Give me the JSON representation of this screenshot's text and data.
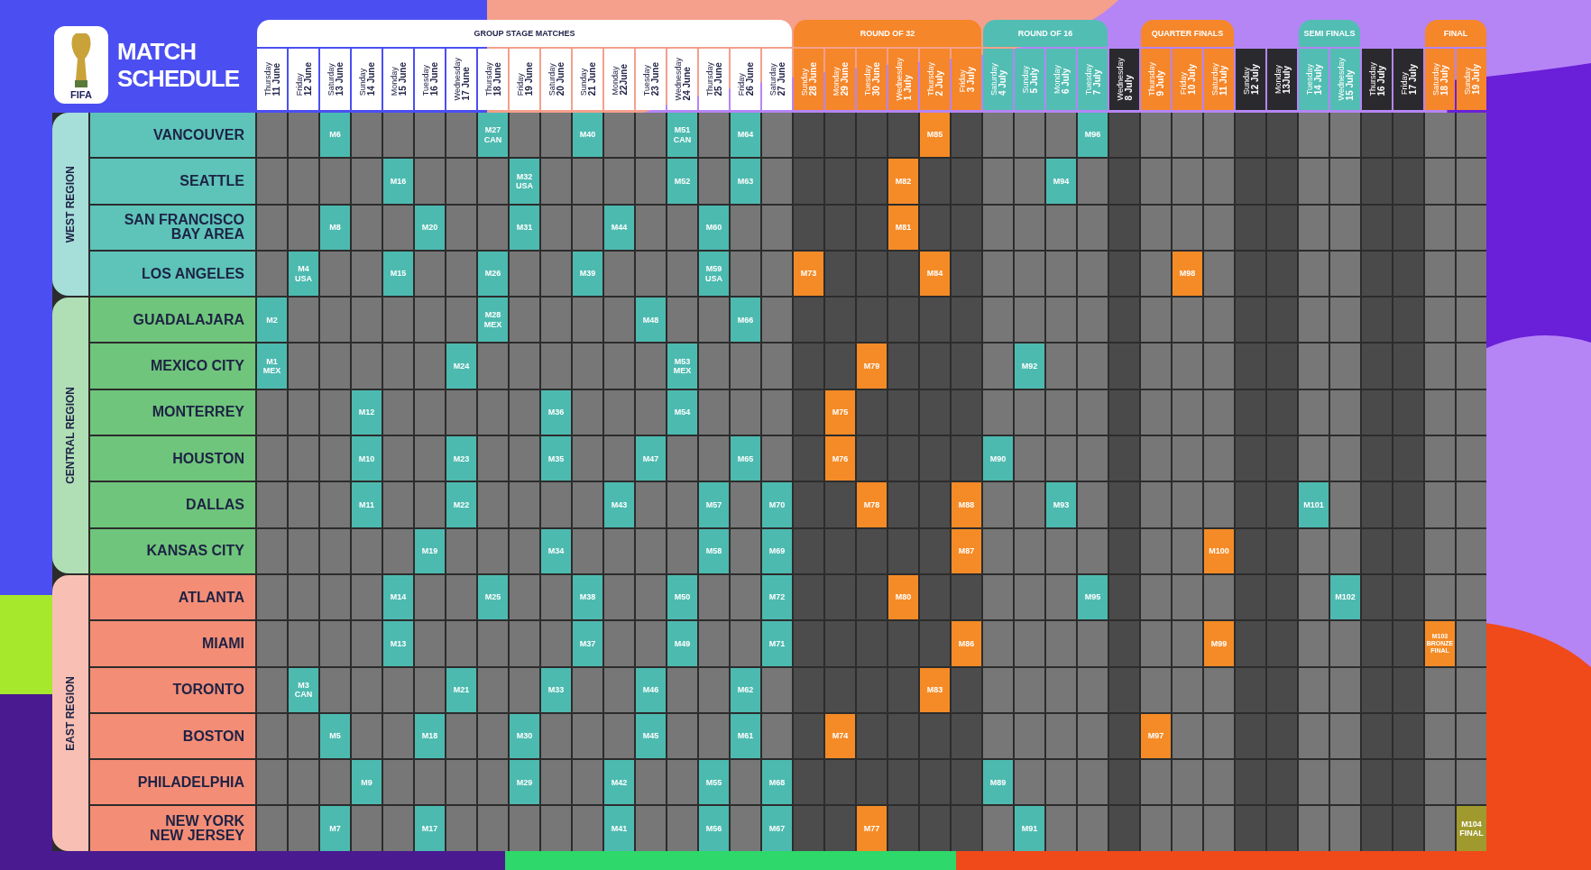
{
  "brand": {
    "logo_text": "FIFA",
    "title": "MATCH\nSCHEDULE"
  },
  "stages": [
    {
      "label": "GROUP STAGE MATCHES",
      "kind": "group",
      "days": [
        {
          "day": "Thursday",
          "date": "11 June"
        },
        {
          "day": "Friday",
          "date": "12 June"
        },
        {
          "day": "Saturday",
          "date": "13 June"
        },
        {
          "day": "Sunday",
          "date": "14 June"
        },
        {
          "day": "Monday",
          "date": "15 June"
        },
        {
          "day": "Tuesday",
          "date": "16 June"
        },
        {
          "day": "Wednesday",
          "date": "17 June"
        },
        {
          "day": "Thursday",
          "date": "18 June"
        },
        {
          "day": "Friday",
          "date": "19 June"
        },
        {
          "day": "Saturday",
          "date": "20 June"
        },
        {
          "day": "Sunday",
          "date": "21 June"
        },
        {
          "day": "Monday",
          "date": "22June"
        },
        {
          "day": "Tuesday",
          "date": "23 June"
        },
        {
          "day": "Wednesday",
          "date": "24 June"
        },
        {
          "day": "Thursday",
          "date": "25 June"
        },
        {
          "day": "Friday",
          "date": "26 June"
        },
        {
          "day": "Saturday",
          "date": "27 June"
        }
      ]
    },
    {
      "label": "ROUND OF 32",
      "kind": "round-of-32",
      "days": [
        {
          "day": "Sunday",
          "date": "28 June"
        },
        {
          "day": "Monday",
          "date": "29 June"
        },
        {
          "day": "Tuesday",
          "date": "30 June"
        },
        {
          "day": "Wednesday",
          "date": "1 July"
        },
        {
          "day": "Thursday",
          "date": "2 July"
        },
        {
          "day": "Friday",
          "date": "3 July"
        }
      ]
    },
    {
      "label": "ROUND OF 16",
      "kind": "round-of-16",
      "days": [
        {
          "day": "Saturday",
          "date": "4 July"
        },
        {
          "day": "Sunday",
          "date": "5 July"
        },
        {
          "day": "Monday",
          "date": "6 July"
        },
        {
          "day": "Tuesday",
          "date": "7 July"
        }
      ]
    },
    {
      "kind": "rest",
      "days": [
        {
          "day": "Wednesday",
          "date": "8 July"
        }
      ]
    },
    {
      "label": "QUARTER FINALS",
      "kind": "quarter-finals",
      "days": [
        {
          "day": "Thursday",
          "date": "9 July"
        },
        {
          "day": "Friday",
          "date": "10 July"
        },
        {
          "day": "Saturday",
          "date": "11 July"
        }
      ]
    },
    {
      "kind": "rest",
      "days": [
        {
          "day": "Sunday",
          "date": "12 July"
        },
        {
          "day": "Monday",
          "date": "13July"
        }
      ]
    },
    {
      "label": "SEMI FINALS",
      "kind": "semi-finals",
      "days": [
        {
          "day": "Tuesday",
          "date": "14 July"
        },
        {
          "day": "Wednesday",
          "date": "15 July"
        }
      ]
    },
    {
      "kind": "rest",
      "days": [
        {
          "day": "Thursday",
          "date": "16 July"
        },
        {
          "day": "Friday",
          "date": "17 July"
        }
      ]
    },
    {
      "label": "FINAL",
      "kind": "final",
      "days": [
        {
          "day": "Saturday",
          "date": "18 July"
        },
        {
          "day": "Sunday",
          "date": "19 July"
        }
      ]
    }
  ],
  "regions": [
    {
      "label": "WEST REGION",
      "color": "#5ec3b9",
      "cities": [
        {
          "name": "VANCOUVER",
          "cells": [
            null,
            null,
            {
              "label": "M6",
              "color": "#4dbab0"
            },
            null,
            null,
            null,
            null,
            {
              "label": "M27\nCAN",
              "color": "#4dbab0"
            },
            null,
            null,
            {
              "label": "M40",
              "color": "#4dbab0"
            },
            null,
            null,
            {
              "label": "M51\nCAN",
              "color": "#4dbab0"
            },
            null,
            {
              "label": "M64",
              "color": "#4dbab0"
            },
            null,
            null,
            null,
            null,
            null,
            {
              "label": "M85",
              "color": "#f58b26"
            },
            null,
            null,
            null,
            null,
            {
              "label": "M96",
              "color": "#4dbab0"
            },
            null,
            null,
            null,
            null,
            null,
            null,
            null,
            null,
            null,
            null,
            null,
            null
          ]
        },
        {
          "name": "SEATTLE",
          "cells": [
            null,
            null,
            null,
            null,
            {
              "label": "M16",
              "color": "#4dbab0"
            },
            null,
            null,
            null,
            {
              "label": "M32\nUSA",
              "color": "#4dbab0"
            },
            null,
            null,
            null,
            null,
            {
              "label": "M52",
              "color": "#4dbab0"
            },
            null,
            {
              "label": "M63",
              "color": "#4dbab0"
            },
            null,
            null,
            null,
            null,
            {
              "label": "M82",
              "color": "#f58b26"
            },
            null,
            null,
            null,
            null,
            {
              "label": "M94",
              "color": "#4dbab0"
            },
            null,
            null,
            null,
            null,
            null,
            null,
            null,
            null,
            null,
            null,
            null,
            null,
            null
          ]
        },
        {
          "name": "SAN FRANCISCO\nBAY AREA",
          "cells": [
            null,
            null,
            {
              "label": "M8",
              "color": "#4dbab0"
            },
            null,
            null,
            {
              "label": "M20",
              "color": "#4dbab0"
            },
            null,
            null,
            {
              "label": "M31",
              "color": "#4dbab0"
            },
            null,
            null,
            {
              "label": "M44",
              "color": "#4dbab0"
            },
            null,
            null,
            {
              "label": "M60",
              "color": "#4dbab0"
            },
            null,
            null,
            null,
            null,
            null,
            {
              "label": "M81",
              "color": "#f58b26"
            },
            null,
            null,
            null,
            null,
            null,
            null,
            null,
            null,
            null,
            null,
            null,
            null,
            null,
            null,
            null,
            null,
            null,
            null
          ]
        },
        {
          "name": "LOS ANGELES",
          "cells": [
            null,
            {
              "label": "M4\nUSA",
              "color": "#4dbab0"
            },
            null,
            null,
            {
              "label": "M15",
              "color": "#4dbab0"
            },
            null,
            null,
            {
              "label": "M26",
              "color": "#4dbab0"
            },
            null,
            null,
            {
              "label": "M39",
              "color": "#4dbab0"
            },
            null,
            null,
            null,
            {
              "label": "M59\nUSA",
              "color": "#4dbab0"
            },
            null,
            null,
            {
              "label": "M73",
              "color": "#f58b26"
            },
            null,
            null,
            null,
            {
              "label": "M84",
              "color": "#f58b26"
            },
            null,
            null,
            null,
            null,
            null,
            null,
            null,
            {
              "label": "M98",
              "color": "#f58b26"
            },
            null,
            null,
            null,
            null,
            null,
            null,
            null,
            null,
            null
          ]
        }
      ]
    },
    {
      "label": "CENTRAL REGION",
      "color": "#6fc57b",
      "cities": [
        {
          "name": "GUADALAJARA",
          "cells": [
            {
              "label": "M2",
              "color": "#4dbab0"
            },
            null,
            null,
            null,
            null,
            null,
            null,
            {
              "label": "M28\nMEX",
              "color": "#4dbab0"
            },
            null,
            null,
            null,
            null,
            {
              "label": "M48",
              "color": "#4dbab0"
            },
            null,
            null,
            {
              "label": "M66",
              "color": "#4dbab0"
            },
            null,
            null,
            null,
            null,
            null,
            null,
            null,
            null,
            null,
            null,
            null,
            null,
            null,
            null,
            null,
            null,
            null,
            null,
            null,
            null,
            null,
            null,
            null
          ]
        },
        {
          "name": "MEXICO CITY",
          "cells": [
            {
              "label": "M1\nMEX",
              "color": "#4dbab0"
            },
            null,
            null,
            null,
            null,
            null,
            {
              "label": "M24",
              "color": "#4dbab0"
            },
            null,
            null,
            null,
            null,
            null,
            null,
            {
              "label": "M53\nMEX",
              "color": "#4dbab0"
            },
            null,
            null,
            null,
            null,
            null,
            {
              "label": "M79",
              "color": "#f58b26"
            },
            null,
            null,
            null,
            null,
            {
              "label": "M92",
              "color": "#4dbab0"
            },
            null,
            null,
            null,
            null,
            null,
            null,
            null,
            null,
            null,
            null,
            null,
            null,
            null,
            null
          ]
        },
        {
          "name": "MONTERREY",
          "cells": [
            null,
            null,
            null,
            {
              "label": "M12",
              "color": "#4dbab0"
            },
            null,
            null,
            null,
            null,
            null,
            {
              "label": "M36",
              "color": "#4dbab0"
            },
            null,
            null,
            null,
            {
              "label": "M54",
              "color": "#4dbab0"
            },
            null,
            null,
            null,
            null,
            {
              "label": "M75",
              "color": "#f58b26"
            },
            null,
            null,
            null,
            null,
            null,
            null,
            null,
            null,
            null,
            null,
            null,
            null,
            null,
            null,
            null,
            null,
            null,
            null,
            null,
            null
          ]
        },
        {
          "name": "HOUSTON",
          "cells": [
            null,
            null,
            null,
            {
              "label": "M10",
              "color": "#4dbab0"
            },
            null,
            null,
            {
              "label": "M23",
              "color": "#4dbab0"
            },
            null,
            null,
            {
              "label": "M35",
              "color": "#4dbab0"
            },
            null,
            null,
            {
              "label": "M47",
              "color": "#4dbab0"
            },
            null,
            null,
            {
              "label": "M65",
              "color": "#4dbab0"
            },
            null,
            null,
            {
              "label": "M76",
              "color": "#f58b26"
            },
            null,
            null,
            null,
            null,
            {
              "label": "M90",
              "color": "#4dbab0"
            },
            null,
            null,
            null,
            null,
            null,
            null,
            null,
            null,
            null,
            null,
            null,
            null,
            null,
            null,
            null
          ]
        },
        {
          "name": "DALLAS",
          "cells": [
            null,
            null,
            null,
            {
              "label": "M11",
              "color": "#4dbab0"
            },
            null,
            null,
            {
              "label": "M22",
              "color": "#4dbab0"
            },
            null,
            null,
            null,
            null,
            {
              "label": "M43",
              "color": "#4dbab0"
            },
            null,
            null,
            {
              "label": "M57",
              "color": "#4dbab0"
            },
            null,
            {
              "label": "M70",
              "color": "#4dbab0"
            },
            null,
            null,
            {
              "label": "M78",
              "color": "#f58b26"
            },
            null,
            null,
            {
              "label": "M88",
              "color": "#f58b26"
            },
            null,
            null,
            {
              "label": "M93",
              "color": "#4dbab0"
            },
            null,
            null,
            null,
            null,
            null,
            null,
            null,
            {
              "label": "M101",
              "color": "#4dbab0"
            },
            null,
            null,
            null,
            null,
            null
          ]
        },
        {
          "name": "KANSAS CITY",
          "cells": [
            null,
            null,
            null,
            null,
            null,
            {
              "label": "M19",
              "color": "#4dbab0"
            },
            null,
            null,
            null,
            {
              "label": "M34",
              "color": "#4dbab0"
            },
            null,
            null,
            null,
            null,
            {
              "label": "M58",
              "color": "#4dbab0"
            },
            null,
            {
              "label": "M69",
              "color": "#4dbab0"
            },
            null,
            null,
            null,
            null,
            null,
            {
              "label": "M87",
              "color": "#f58b26"
            },
            null,
            null,
            null,
            null,
            null,
            null,
            null,
            {
              "label": "M100",
              "color": "#f58b26"
            },
            null,
            null,
            null,
            null,
            null,
            null,
            null,
            null
          ]
        }
      ]
    },
    {
      "label": "EAST REGION",
      "color": "#f38d76",
      "cities": [
        {
          "name": "ATLANTA",
          "cells": [
            null,
            null,
            null,
            null,
            {
              "label": "M14",
              "color": "#4dbab0"
            },
            null,
            null,
            {
              "label": "M25",
              "color": "#4dbab0"
            },
            null,
            null,
            {
              "label": "M38",
              "color": "#4dbab0"
            },
            null,
            null,
            {
              "label": "M50",
              "color": "#4dbab0"
            },
            null,
            null,
            {
              "label": "M72",
              "color": "#4dbab0"
            },
            null,
            null,
            null,
            {
              "label": "M80",
              "color": "#f58b26"
            },
            null,
            null,
            null,
            null,
            null,
            {
              "label": "M95",
              "color": "#4dbab0"
            },
            null,
            null,
            null,
            null,
            null,
            null,
            null,
            {
              "label": "M102",
              "color": "#4dbab0"
            },
            null,
            null,
            null,
            null
          ]
        },
        {
          "name": "MIAMI",
          "cells": [
            null,
            null,
            null,
            null,
            {
              "label": "M13",
              "color": "#4dbab0"
            },
            null,
            null,
            null,
            null,
            null,
            {
              "label": "M37",
              "color": "#4dbab0"
            },
            null,
            null,
            {
              "label": "M49",
              "color": "#4dbab0"
            },
            null,
            null,
            {
              "label": "M71",
              "color": "#4dbab0"
            },
            null,
            null,
            null,
            null,
            null,
            {
              "label": "M86",
              "color": "#f58b26"
            },
            null,
            null,
            null,
            null,
            null,
            null,
            null,
            {
              "label": "M99",
              "color": "#f58b26"
            },
            null,
            null,
            null,
            null,
            null,
            null,
            {
              "label": "M103\nBRONZE\nFINAL",
              "color": "#f58b26"
            },
            null
          ]
        },
        {
          "name": "TORONTO",
          "cells": [
            null,
            {
              "label": "M3\nCAN",
              "color": "#4dbab0"
            },
            null,
            null,
            null,
            null,
            {
              "label": "M21",
              "color": "#4dbab0"
            },
            null,
            null,
            {
              "label": "M33",
              "color": "#4dbab0"
            },
            null,
            null,
            {
              "label": "M46",
              "color": "#4dbab0"
            },
            null,
            null,
            {
              "label": "M62",
              "color": "#4dbab0"
            },
            null,
            null,
            null,
            null,
            null,
            {
              "label": "M83",
              "color": "#f58b26"
            },
            null,
            null,
            null,
            null,
            null,
            null,
            null,
            null,
            null,
            null,
            null,
            null,
            null,
            null,
            null,
            null,
            null
          ]
        },
        {
          "name": "BOSTON",
          "cells": [
            null,
            null,
            {
              "label": "M5",
              "color": "#4dbab0"
            },
            null,
            null,
            {
              "label": "M18",
              "color": "#4dbab0"
            },
            null,
            null,
            {
              "label": "M30",
              "color": "#4dbab0"
            },
            null,
            null,
            null,
            {
              "label": "M45",
              "color": "#4dbab0"
            },
            null,
            null,
            {
              "label": "M61",
              "color": "#4dbab0"
            },
            null,
            null,
            {
              "label": "M74",
              "color": "#f58b26"
            },
            null,
            null,
            null,
            null,
            null,
            null,
            null,
            null,
            null,
            {
              "label": "M97",
              "color": "#f58b26"
            },
            null,
            null,
            null,
            null,
            null,
            null,
            null,
            null,
            null,
            null
          ]
        },
        {
          "name": "PHILADELPHIA",
          "cells": [
            null,
            null,
            null,
            {
              "label": "M9",
              "color": "#4dbab0"
            },
            null,
            null,
            null,
            null,
            {
              "label": "M29",
              "color": "#4dbab0"
            },
            null,
            null,
            {
              "label": "M42",
              "color": "#4dbab0"
            },
            null,
            null,
            {
              "label": "M55",
              "color": "#4dbab0"
            },
            null,
            {
              "label": "M68",
              "color": "#4dbab0"
            },
            null,
            null,
            null,
            null,
            null,
            null,
            {
              "label": "M89",
              "color": "#4dbab0"
            },
            null,
            null,
            null,
            null,
            null,
            null,
            null,
            null,
            null,
            null,
            null,
            null,
            null,
            null,
            null
          ]
        },
        {
          "name": "NEW YORK\nNEW JERSEY",
          "cells": [
            null,
            null,
            {
              "label": "M7",
              "color": "#4dbab0"
            },
            null,
            null,
            {
              "label": "M17",
              "color": "#4dbab0"
            },
            null,
            null,
            null,
            null,
            null,
            {
              "label": "M41",
              "color": "#4dbab0"
            },
            null,
            null,
            {
              "label": "M56",
              "color": "#4dbab0"
            },
            null,
            {
              "label": "M67",
              "color": "#4dbab0"
            },
            null,
            null,
            {
              "label": "M77",
              "color": "#f58b26"
            },
            null,
            null,
            null,
            null,
            {
              "label": "M91",
              "color": "#4dbab0"
            },
            null,
            null,
            null,
            null,
            null,
            null,
            null,
            null,
            null,
            null,
            null,
            null,
            null,
            {
              "label": "M104\nFINAL",
              "color": "#a09a2e"
            }
          ]
        }
      ]
    }
  ]
}
